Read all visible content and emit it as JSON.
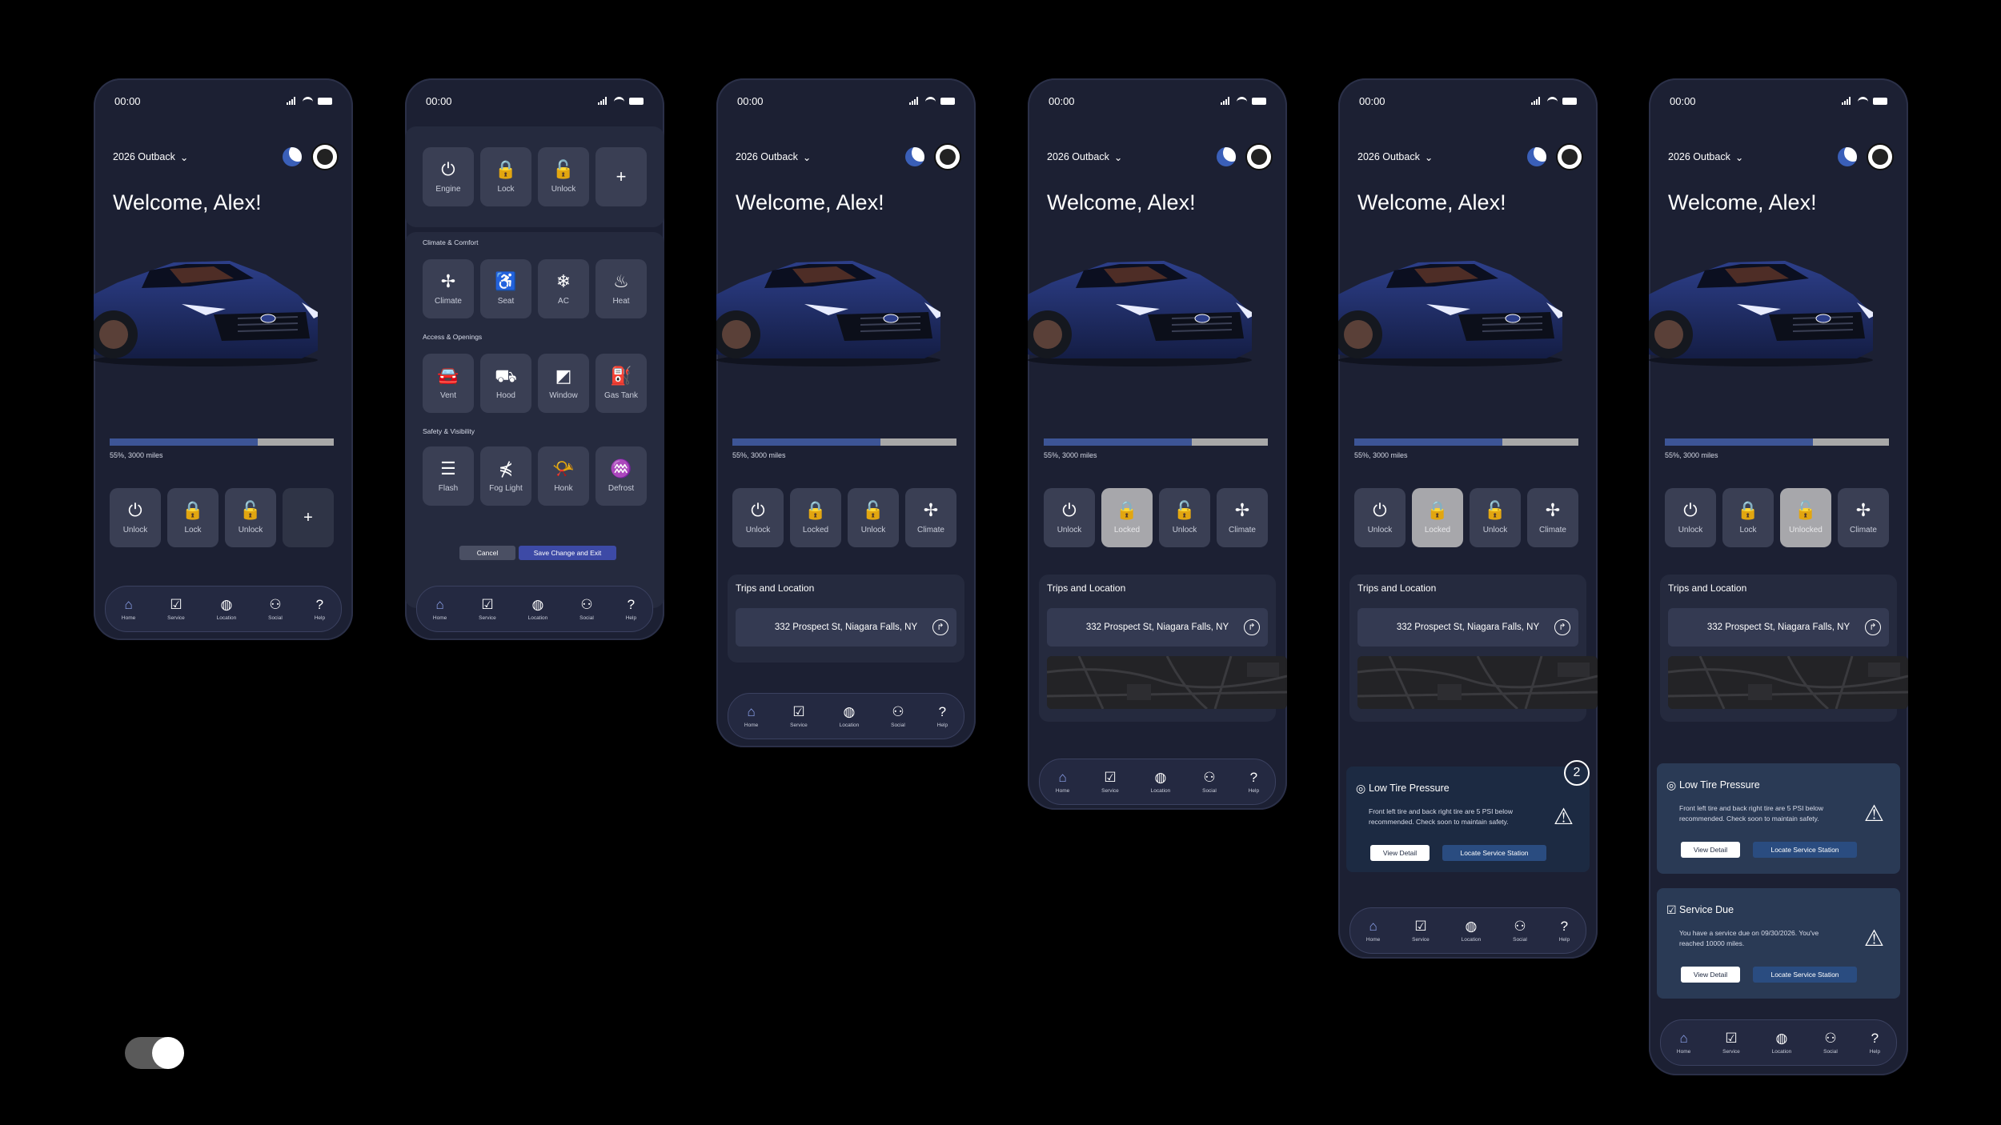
{
  "status_time": "00:00",
  "model_label": "2026 Outback",
  "welcome": "Welcome, Alex!",
  "battery": {
    "percent": 55,
    "label": "55%, 3000 miles"
  },
  "screens": [
    {
      "id": "home-basic",
      "quick_actions": [
        {
          "label": "Unlock",
          "icon": "power-icon",
          "highlighted": false
        },
        {
          "label": "Lock",
          "icon": "lock-icon",
          "highlighted": false
        },
        {
          "label": "Unlock",
          "icon": "unlock-icon",
          "highlighted": false
        },
        {
          "label": "",
          "icon": "plus-icon",
          "highlighted": false
        }
      ]
    },
    {
      "id": "home-trips",
      "quick_actions": [
        {
          "label": "Unlock",
          "icon": "power-icon",
          "highlighted": false
        },
        {
          "label": "Locked",
          "icon": "lock-icon",
          "highlighted": false
        },
        {
          "label": "Unlock",
          "icon": "unlock-icon",
          "highlighted": false
        },
        {
          "label": "Climate",
          "icon": "fan-icon",
          "highlighted": false
        }
      ]
    },
    {
      "id": "home-map",
      "quick_actions": [
        {
          "label": "Unlock",
          "icon": "power-icon",
          "highlighted": false
        },
        {
          "label": "Locked",
          "icon": "lock-icon",
          "highlighted": true
        },
        {
          "label": "Unlock",
          "icon": "unlock-icon",
          "highlighted": false
        },
        {
          "label": "Climate",
          "icon": "fan-icon",
          "highlighted": false
        }
      ]
    },
    {
      "id": "home-alert",
      "quick_actions": [
        {
          "label": "Unlock",
          "icon": "power-icon",
          "highlighted": false
        },
        {
          "label": "Locked",
          "icon": "lock-icon",
          "highlighted": true
        },
        {
          "label": "Unlock",
          "icon": "unlock-icon",
          "highlighted": false
        },
        {
          "label": "Climate",
          "icon": "fan-icon",
          "highlighted": false
        }
      ]
    },
    {
      "id": "home-alerts",
      "quick_actions": [
        {
          "label": "Unlock",
          "icon": "power-icon",
          "highlighted": false
        },
        {
          "label": "Lock",
          "icon": "lock-icon",
          "highlighted": false
        },
        {
          "label": "Unlocked",
          "icon": "unlock-icon",
          "highlighted": true
        },
        {
          "label": "Climate",
          "icon": "fan-icon",
          "highlighted": false
        }
      ]
    }
  ],
  "edit_screen": {
    "top_row": [
      {
        "label": "Engine",
        "icon": "power-icon"
      },
      {
        "label": "Lock",
        "icon": "lock-icon"
      },
      {
        "label": "Unlock",
        "icon": "unlock-icon"
      },
      {
        "label": "",
        "icon": "plus-icon"
      }
    ],
    "sections": [
      {
        "title": "Climate & Comfort",
        "items": [
          {
            "label": "Climate",
            "icon": "fan-icon"
          },
          {
            "label": "Seat",
            "icon": "seat-icon"
          },
          {
            "label": "AC",
            "icon": "ac-icon"
          },
          {
            "label": "Heat",
            "icon": "heat-icon"
          }
        ]
      },
      {
        "title": "Access & Openings",
        "items": [
          {
            "label": "Vent",
            "icon": "car-icon"
          },
          {
            "label": "Hood",
            "icon": "hood-icon"
          },
          {
            "label": "Window",
            "icon": "window-icon"
          },
          {
            "label": "Gas Tank",
            "icon": "fuel-icon"
          }
        ]
      },
      {
        "title": "Safety & Visibility",
        "items": [
          {
            "label": "Flash",
            "icon": "headlight-icon"
          },
          {
            "label": "Fog Light",
            "icon": "fog-light-icon"
          },
          {
            "label": "Honk",
            "icon": "horn-icon"
          },
          {
            "label": "Defrost",
            "icon": "defrost-icon"
          }
        ]
      }
    ],
    "cancel_label": "Cancel",
    "save_label": "Save Change and Exit"
  },
  "trips": {
    "title": "Trips and Location",
    "address": "332 Prospect St, Niagara Falls, NY"
  },
  "alerts": {
    "count_badge": "2",
    "tire": {
      "title": "Low Tire Pressure",
      "body": "Front left tire and back right tire are 5 PSI below recommended. Check soon to maintain safety.",
      "view_label": "View Detail",
      "locate_label": "Locate Service Station"
    },
    "service": {
      "title": "Service Due",
      "body": "You have a service due on 09/30/2026. You've reached 10000 miles.",
      "view_label": "View Detail",
      "locate_label": "Locate Service Station"
    }
  },
  "nav": [
    {
      "label": "Home",
      "icon": "home-icon"
    },
    {
      "label": "Service",
      "icon": "calendar-check-icon"
    },
    {
      "label": "Location",
      "icon": "globe-icon"
    },
    {
      "label": "Social",
      "icon": "people-icon"
    },
    {
      "label": "Help",
      "icon": "help-icon"
    }
  ],
  "colors": {
    "background": "#000000",
    "phone_bg": "#1c2033",
    "accent": "#3d5596",
    "active_nav": "#8ea4ef",
    "alert_card": "#1e2940",
    "locate_button": "#2a4c80"
  }
}
